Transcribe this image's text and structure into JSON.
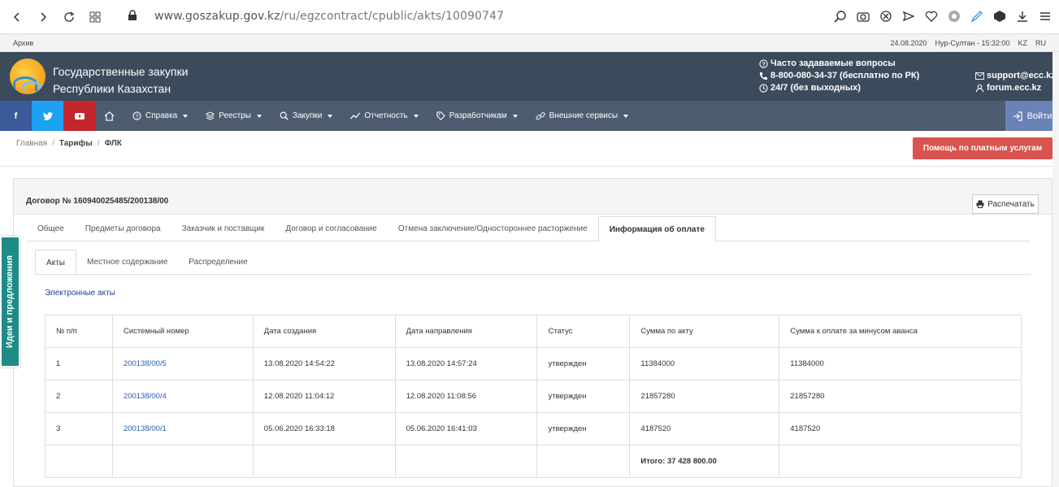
{
  "browser": {
    "url_host": "www.goszakup.gov.kz",
    "url_path": "/ru/egzcontract/cpublic/akts/10090747"
  },
  "topstrip": {
    "archive": "Архив",
    "date": "24.08.2020",
    "time": "Нур-Султан - 15:32:00",
    "lang_kz": "KZ",
    "lang_ru": "RU"
  },
  "header": {
    "title_line1": "Государственные закупки",
    "title_line2": "Республики Казахстан",
    "faq": "Часто задаваемые вопросы",
    "phone": "8-800-080-34-37 (бесплатно по РК)",
    "hours": "24/7 (без выходных)",
    "email": "support@ecc.kz",
    "forum": "forum.ecc.kz"
  },
  "menu": {
    "facebook": "f",
    "items": [
      "Справка",
      "Реестры",
      "Закупки",
      "Отчетность",
      "Разработчикам",
      "Внешние сервисы"
    ],
    "login": "Войти"
  },
  "breadcrumb": {
    "home": "Главная",
    "tariffs": "Тарифы",
    "current": "ФЛК"
  },
  "help_button": "Помощь по платным услугам",
  "panel": {
    "contract_number": "Договор № 160940025485/200138/00",
    "print": "Распечатать",
    "tabs": [
      "Общее",
      "Предметы договора",
      "Заказчик и поставщик",
      "Договор и согласование",
      "Отмена заключение/Одностороннее расторжение",
      "Информация об оплате"
    ],
    "subtabs": [
      "Акты",
      "Местное содержание",
      "Распределение"
    ],
    "section_title": "Электронные акты"
  },
  "table": {
    "headers": [
      "№ п/п",
      "Системный номер",
      "Дата создания",
      "Дата направления",
      "Статус",
      "Сумма по акту",
      "Сумма к оплате за минусом аванса"
    ],
    "rows": [
      [
        "1",
        "200138/00/5",
        "13.08.2020 14:54:22",
        "13.08.2020 14:57:24",
        "утвержден",
        "11384000",
        "11384000"
      ],
      [
        "2",
        "200138/00/4",
        "12.08.2020 11:04:12",
        "12.08.2020 11:08:56",
        "утвержден",
        "21857280",
        "21857280"
      ],
      [
        "3",
        "200138/00/1",
        "05.06.2020 16:33:18",
        "05.06.2020 16:41:03",
        "утвержден",
        "4187520",
        "4187520"
      ]
    ],
    "total": "Итого: 37 428 800.00"
  },
  "side_tab": "Идеи и предложения"
}
